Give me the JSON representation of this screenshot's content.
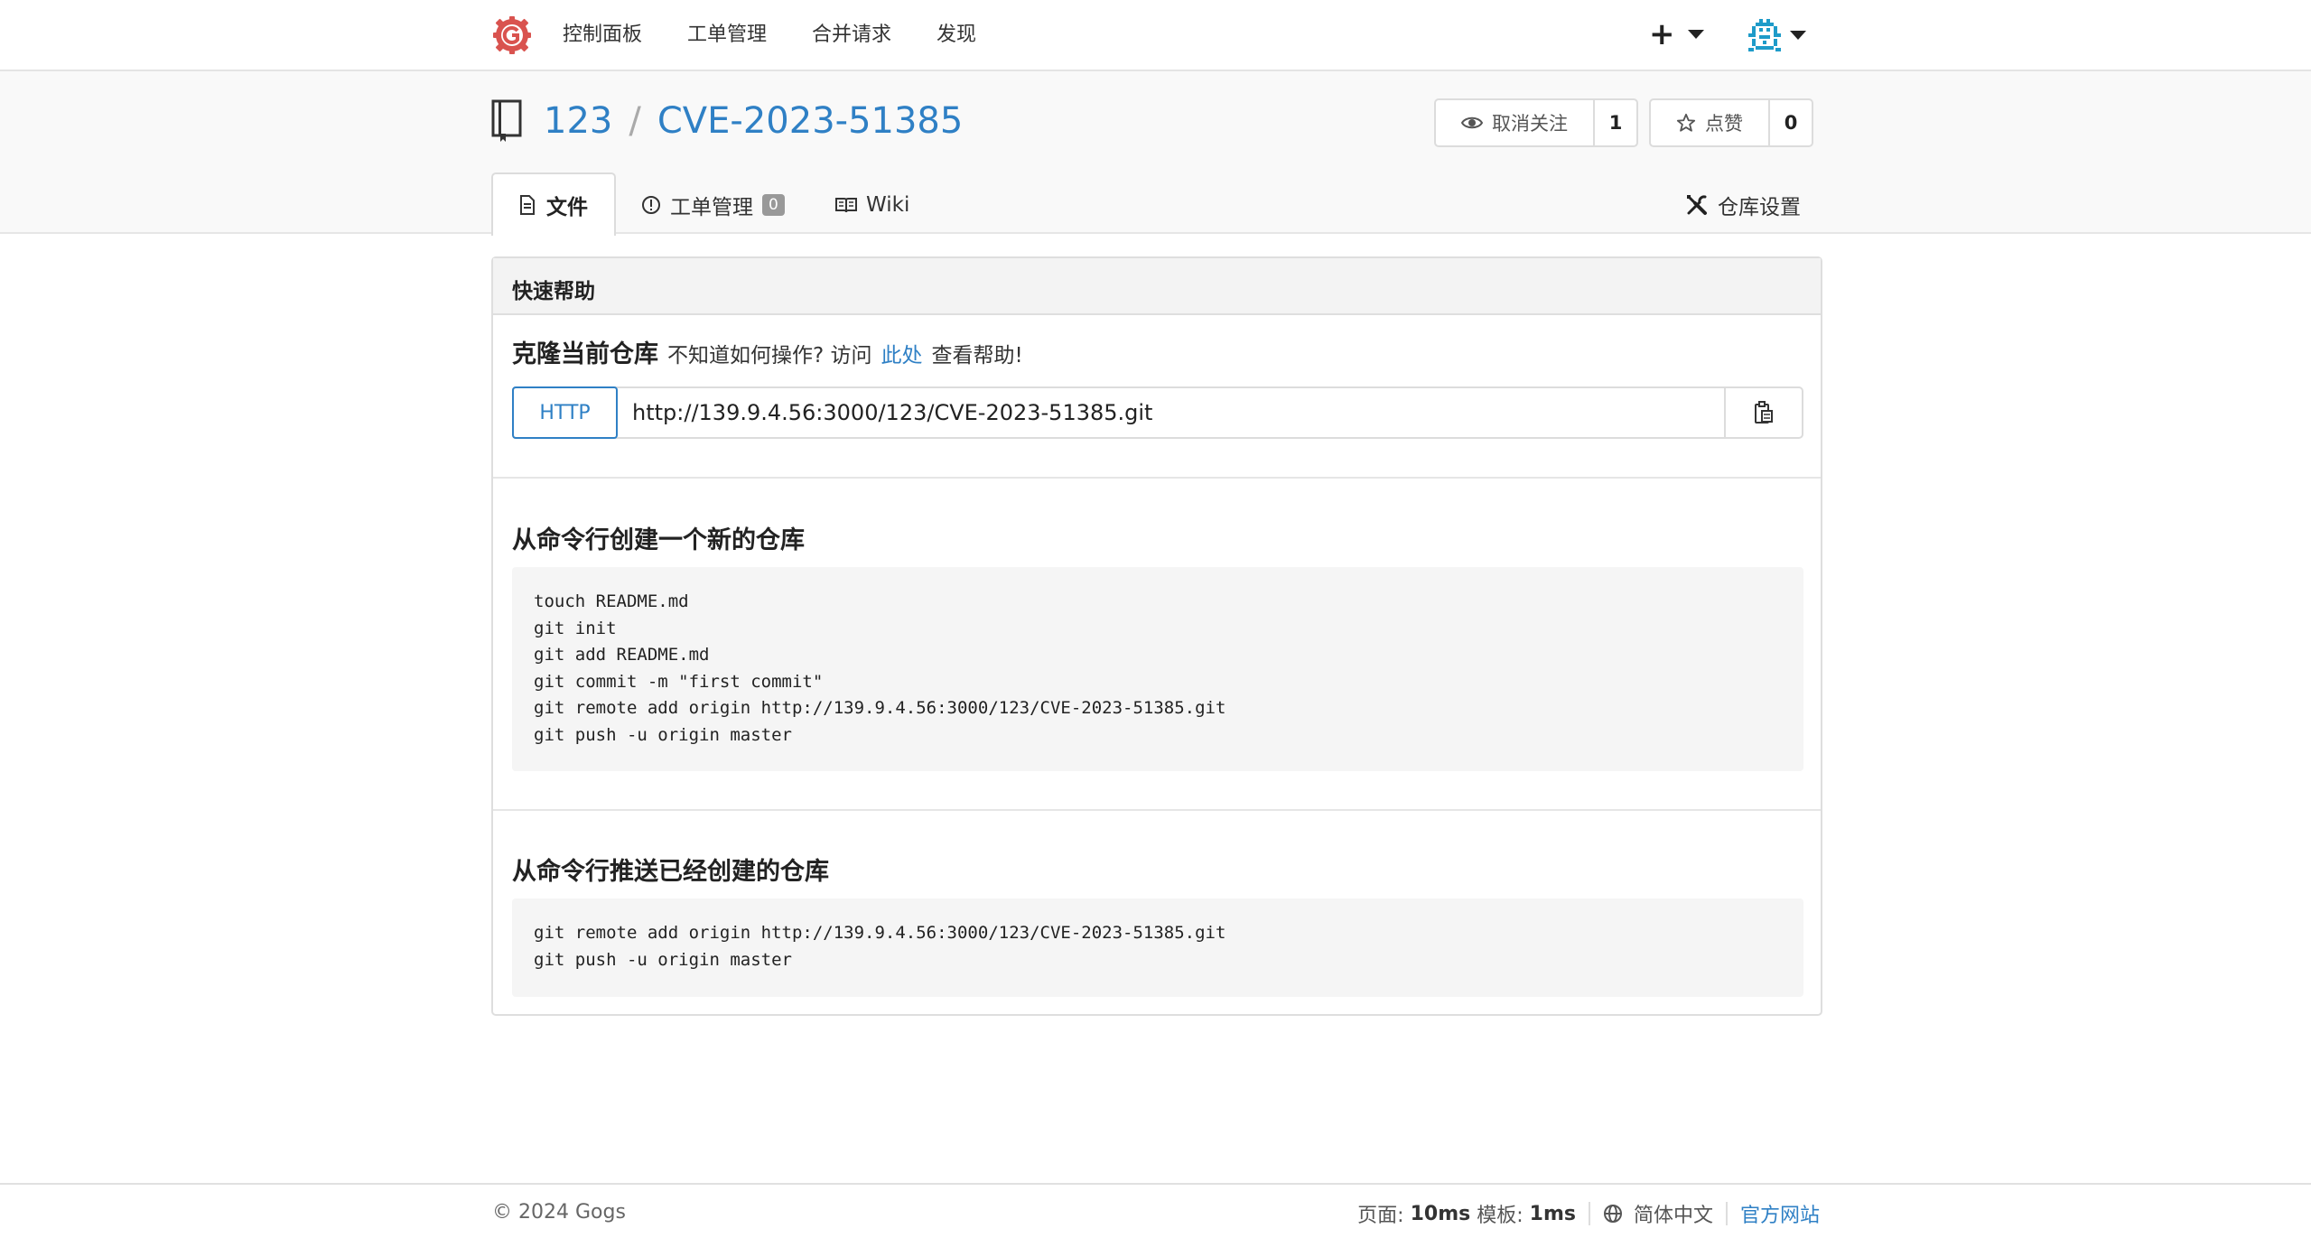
{
  "nav": {
    "items": [
      "控制面板",
      "工单管理",
      "合并请求",
      "发现"
    ],
    "plus": "+"
  },
  "repo": {
    "owner": "123",
    "separator": "/",
    "name": "CVE-2023-51385",
    "unwatch_label": "取消关注",
    "watch_count": "1",
    "star_label": "点赞",
    "star_count": "0"
  },
  "tabs": {
    "files": "文件",
    "issues": "工单管理",
    "issues_count": "0",
    "wiki": "Wiki",
    "settings": "仓库设置"
  },
  "quick_help": {
    "title": "快速帮助",
    "clone_title": "克隆当前仓库",
    "clone_hint_prefix": "不知道如何操作? 访问",
    "clone_hint_link": "此处",
    "clone_hint_suffix": "查看帮助!",
    "protocol": "HTTP",
    "clone_url": "http://139.9.4.56:3000/123/CVE-2023-51385.git",
    "new_repo_title": "从命令行创建一个新的仓库",
    "new_repo_cmds": [
      "touch README.md",
      "git init",
      "git add README.md",
      "git commit -m \"first commit\"",
      "git remote add origin http://139.9.4.56:3000/123/CVE-2023-51385.git",
      "git push -u origin master"
    ],
    "push_repo_title": "从命令行推送已经创建的仓库",
    "push_repo_cmds": [
      "git remote add origin http://139.9.4.56:3000/123/CVE-2023-51385.git",
      "git push -u origin master"
    ]
  },
  "footer": {
    "copyright": "© 2024 Gogs",
    "page_label": "页面:",
    "page_time": "10ms",
    "template_label": "模板:",
    "template_time": "1ms",
    "language": "简体中文",
    "official_site": "官方网站"
  },
  "colors": {
    "link": "#2f80c5",
    "logo": "#d9534f",
    "avatar": "#1e9bc9"
  }
}
